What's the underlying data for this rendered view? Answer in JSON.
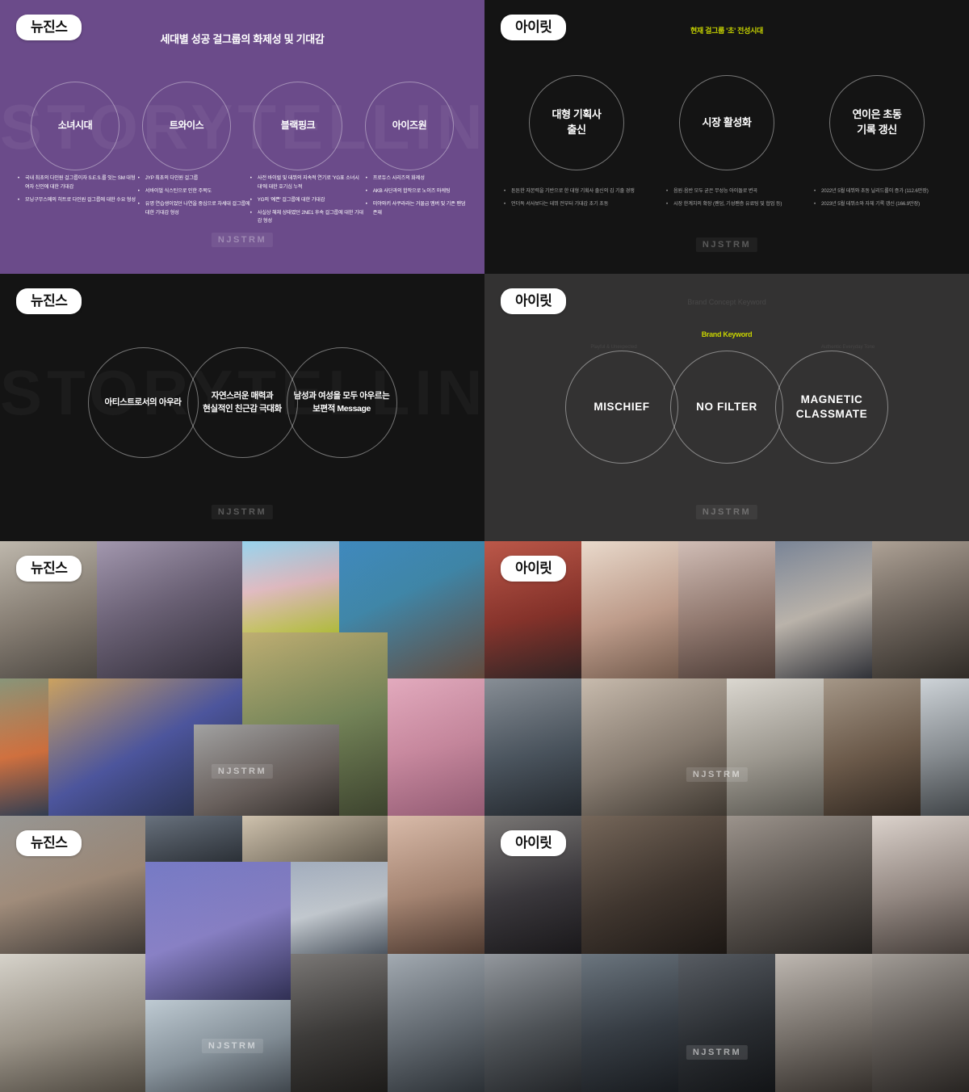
{
  "deck": {
    "watermark_stamp": "NJSTRM",
    "background_watermark": "STORYTELLING",
    "accent_color": "#c8d400",
    "purple_color": "#6b4b8a"
  },
  "panels": [
    {
      "id": "generation-comparison",
      "badge": "뉴진스",
      "title": "세대별 성공 걸그룹의 화제성 및 기대감",
      "circles": [
        {
          "label": "소녀시대"
        },
        {
          "label": "트와이스"
        },
        {
          "label": "블랙핑크"
        },
        {
          "label": "아이즈원"
        }
      ],
      "bullet_groups": [
        {
          "items": [
            "국내 최초의 다인원 걸그룹이자 S.E.S.를 잇는 SM 대형 여자 신인에 대한 기대감",
            "모닝구무스메의 히트로 다인원 걸그룹에 대한 수요 형성"
          ]
        },
        {
          "items": [
            "JYP 최초의 다인원 걸그룹",
            "서바이벌 식스틴으로 인한 주목도",
            "유명 연습생이었던 나연을 중심으로 차세대 걸그룹에 대한 기대감 형성"
          ]
        },
        {
          "items": [
            "사전 바이럴 및 데뷔의 지속적 연기로 'YG표 소녀시대'에 대한 호기심 누적",
            "YG의 '예쁜' 걸그룹에 대한 기대감",
            "사실상 해체 상태였던 2NE1 후속 걸그룹에 대한 기대감 형성"
          ]
        },
        {
          "items": [
            "프로듀스 시리즈의 화제성",
            "AKB 사단과의 합작으로 노이즈 마케팅",
            "미야와키 사쿠라라는 거물급 멤버 및 기존 팬덤 존재"
          ]
        }
      ]
    },
    {
      "id": "current-market",
      "badge": "아이릿",
      "title": "현재 걸그룹 '초' 전성시대",
      "circles": [
        {
          "label": "대형 기획사\n출신"
        },
        {
          "label": "시장 활성화"
        },
        {
          "label": "연이은 초동\n기록 갱신"
        }
      ],
      "bullet_groups": [
        {
          "items": [
            "튼튼한 자본력을 기반으로 한 대형 기획사 출신의 김 기출 경쟁",
            "언더독 서사보다는 데뷔 전부터 기대감 초기 초동"
          ]
        },
        {
          "items": [
            "음원·음반 모두 굳은 무성능 아이돌로 변곡",
            "시장 한계치의 확장 (팬덤, 기성팬층 유료팅 및 협업 등)"
          ]
        },
        {
          "items": [
            "2022년 5월 데뷔와 초동 닐리드롤이 증가 (112.6만장)",
            "2023년 5월 데뷔소와 자체 기록 갱신 (166.9만장)"
          ]
        }
      ]
    },
    {
      "id": "newjeans-positioning",
      "badge": "뉴진스",
      "title": "",
      "circles": [
        {
          "label": "아티스트로서의 아우라"
        },
        {
          "label": "자연스러운 매력과\n현실적인 친근감 극대화"
        },
        {
          "label": "남성과 여성을 모두 아우르는\n보편적 Message"
        }
      ]
    },
    {
      "id": "illit-brand-keyword",
      "badge": "아이릿",
      "section_label": "Brand Keyword",
      "circles": [
        {
          "label": "MISCHIEF"
        },
        {
          "label": "NO FILTER"
        },
        {
          "label": "MAGNETIC\nCLASSMATE"
        }
      ]
    },
    {
      "id": "newjeans-moodboard-1",
      "badge": "뉴진스"
    },
    {
      "id": "illit-moodboard-1",
      "badge": "아이릿"
    },
    {
      "id": "newjeans-moodboard-2",
      "badge": "뉴진스"
    },
    {
      "id": "illit-moodboard-2",
      "badge": "아이릿"
    }
  ]
}
